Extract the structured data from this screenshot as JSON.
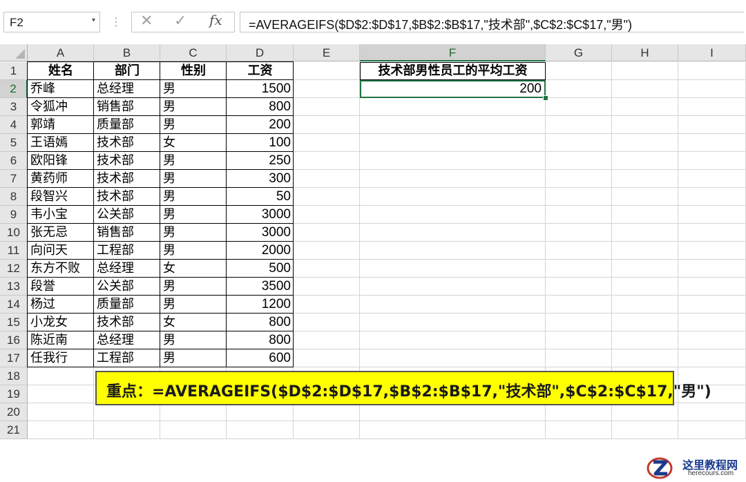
{
  "formula_bar": {
    "name_box": "F2",
    "name_box_arrow": "▾",
    "separator": "⋮",
    "cancel_icon": "✕",
    "enter_icon": "✓",
    "fx_label": "fx",
    "formula": "=AVERAGEIFS($D$2:$D$17,$B$2:$B$17,\"技术部\",$C$2:$C$17,\"男\")"
  },
  "columns": [
    "A",
    "B",
    "C",
    "D",
    "E",
    "F",
    "G",
    "H",
    "I"
  ],
  "selected_column": "F",
  "rows": [
    "1",
    "2",
    "3",
    "4",
    "5",
    "6",
    "7",
    "8",
    "9",
    "10",
    "11",
    "12",
    "13",
    "14",
    "15",
    "16",
    "17",
    "18",
    "19",
    "20",
    "21"
  ],
  "selected_row": "2",
  "table": {
    "headers": [
      "姓名",
      "部门",
      "性别",
      "工资"
    ],
    "records": [
      [
        "乔峰",
        "总经理",
        "男",
        "1500"
      ],
      [
        "令狐冲",
        "销售部",
        "男",
        "800"
      ],
      [
        "郭靖",
        "质量部",
        "男",
        "200"
      ],
      [
        "王语嫣",
        "技术部",
        "女",
        "100"
      ],
      [
        "欧阳锋",
        "技术部",
        "男",
        "250"
      ],
      [
        "黄药师",
        "技术部",
        "男",
        "300"
      ],
      [
        "段智兴",
        "技术部",
        "男",
        "50"
      ],
      [
        "韦小宝",
        "公关部",
        "男",
        "3000"
      ],
      [
        "张无忌",
        "销售部",
        "男",
        "3000"
      ],
      [
        "向问天",
        "工程部",
        "男",
        "2000"
      ],
      [
        "东方不败",
        "总经理",
        "女",
        "500"
      ],
      [
        "段誉",
        "公关部",
        "男",
        "3500"
      ],
      [
        "杨过",
        "质量部",
        "男",
        "1200"
      ],
      [
        "小龙女",
        "技术部",
        "女",
        "800"
      ],
      [
        "陈近南",
        "总经理",
        "男",
        "800"
      ],
      [
        "任我行",
        "工程部",
        "男",
        "600"
      ]
    ]
  },
  "result": {
    "header": "技术部男性员工的平均工资",
    "value": "200"
  },
  "note": "重点：=AVERAGEIFS($D$2:$D$17,$B$2:$B$17,\"技术部\",$C$2:$C$17,\"男\")",
  "watermark": {
    "title": "这里教程网",
    "url": "herecours.com"
  },
  "colors": {
    "accent": "#217346",
    "highlight": "#ffff00",
    "header_bg": "#e6e6e6"
  }
}
